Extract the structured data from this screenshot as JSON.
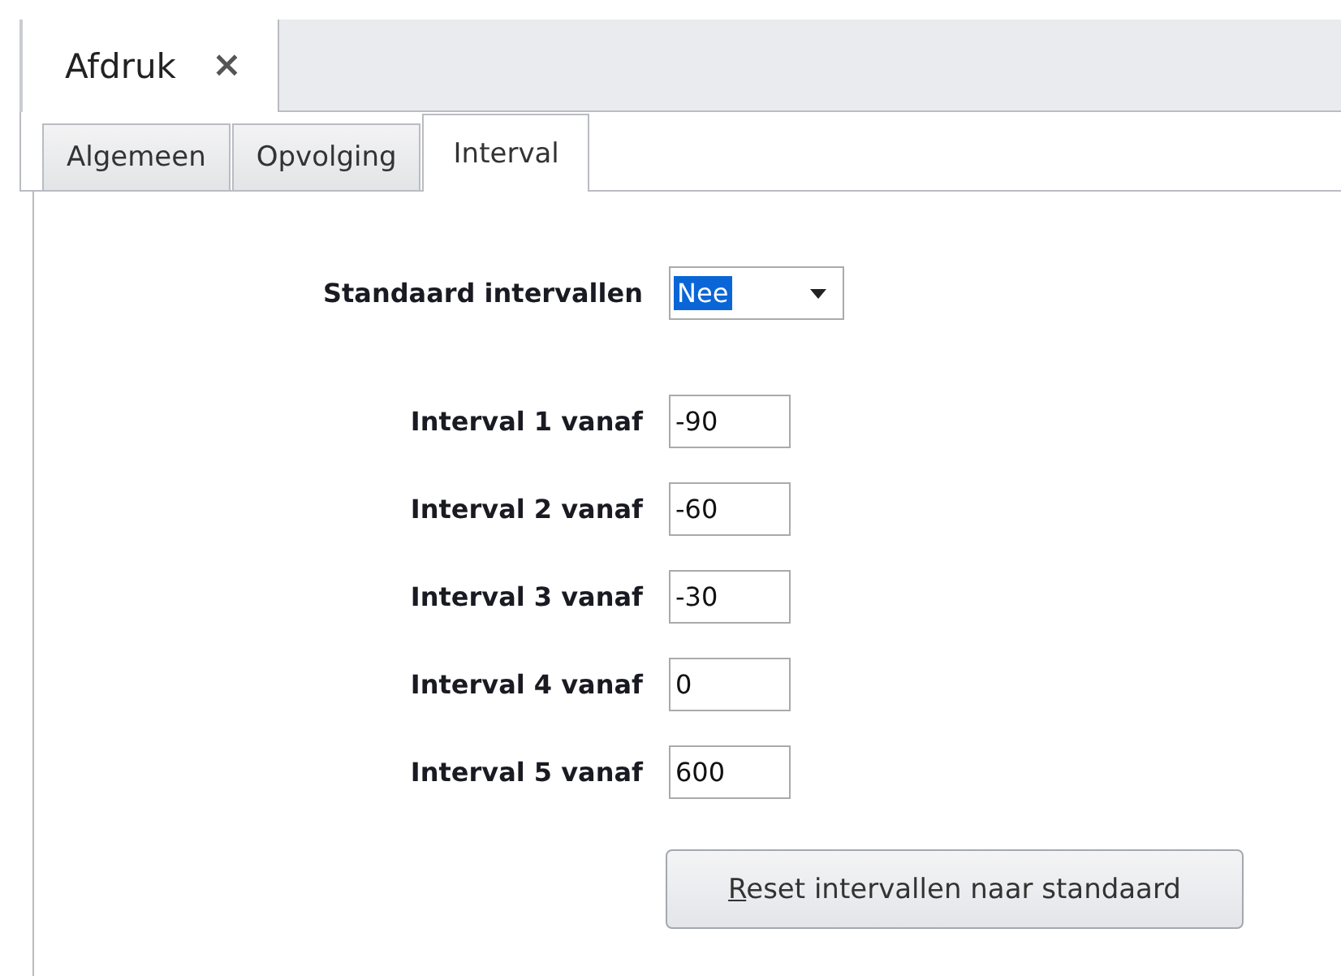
{
  "document_tabs": [
    {
      "label": "Afdruk",
      "selected": true,
      "close_glyph": "×"
    }
  ],
  "tabs": [
    {
      "label": "Algemeen",
      "selected": false
    },
    {
      "label": "Opvolging",
      "selected": false
    },
    {
      "label": "Interval",
      "selected": true
    }
  ],
  "standard_intervals": {
    "label": "Standaard intervallen",
    "value": "Nee",
    "highlighted": true
  },
  "intervals": [
    {
      "label": "Interval 1 vanaf",
      "value": "-90"
    },
    {
      "label": "Interval 2 vanaf",
      "value": "-60"
    },
    {
      "label": "Interval 3 vanaf",
      "value": "-30"
    },
    {
      "label": "Interval 4 vanaf",
      "value": "0"
    },
    {
      "label": "Interval 5 vanaf",
      "value": "600"
    }
  ],
  "reset_button": {
    "label": "Reset intervallen naar standaard",
    "mnemonic_underlined": true
  }
}
